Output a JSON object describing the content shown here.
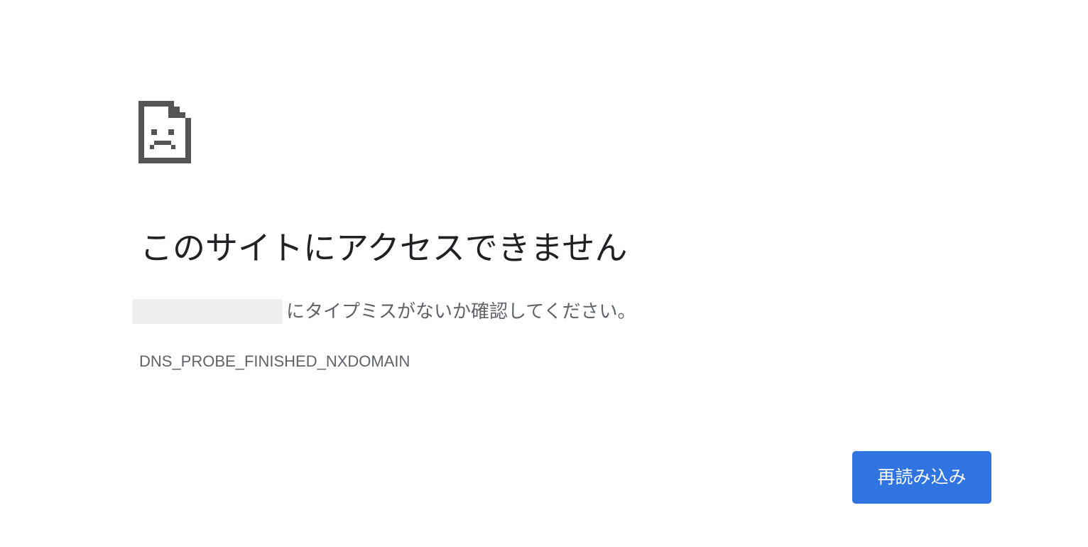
{
  "icon": "sad-page-icon",
  "title": "このサイトにアクセスできません",
  "message": {
    "suffix": "にタイプミスがないか確認してください。"
  },
  "error_code": "DNS_PROBE_FINISHED_NXDOMAIN",
  "reload_button": {
    "label": "再読み込み"
  },
  "colors": {
    "background": "#ffffff",
    "title_text": "#202124",
    "secondary_text": "#5f6368",
    "icon": "#555555",
    "redaction": "#eeeeee",
    "button_background": "#2f74e0",
    "button_text": "#ffffff"
  }
}
